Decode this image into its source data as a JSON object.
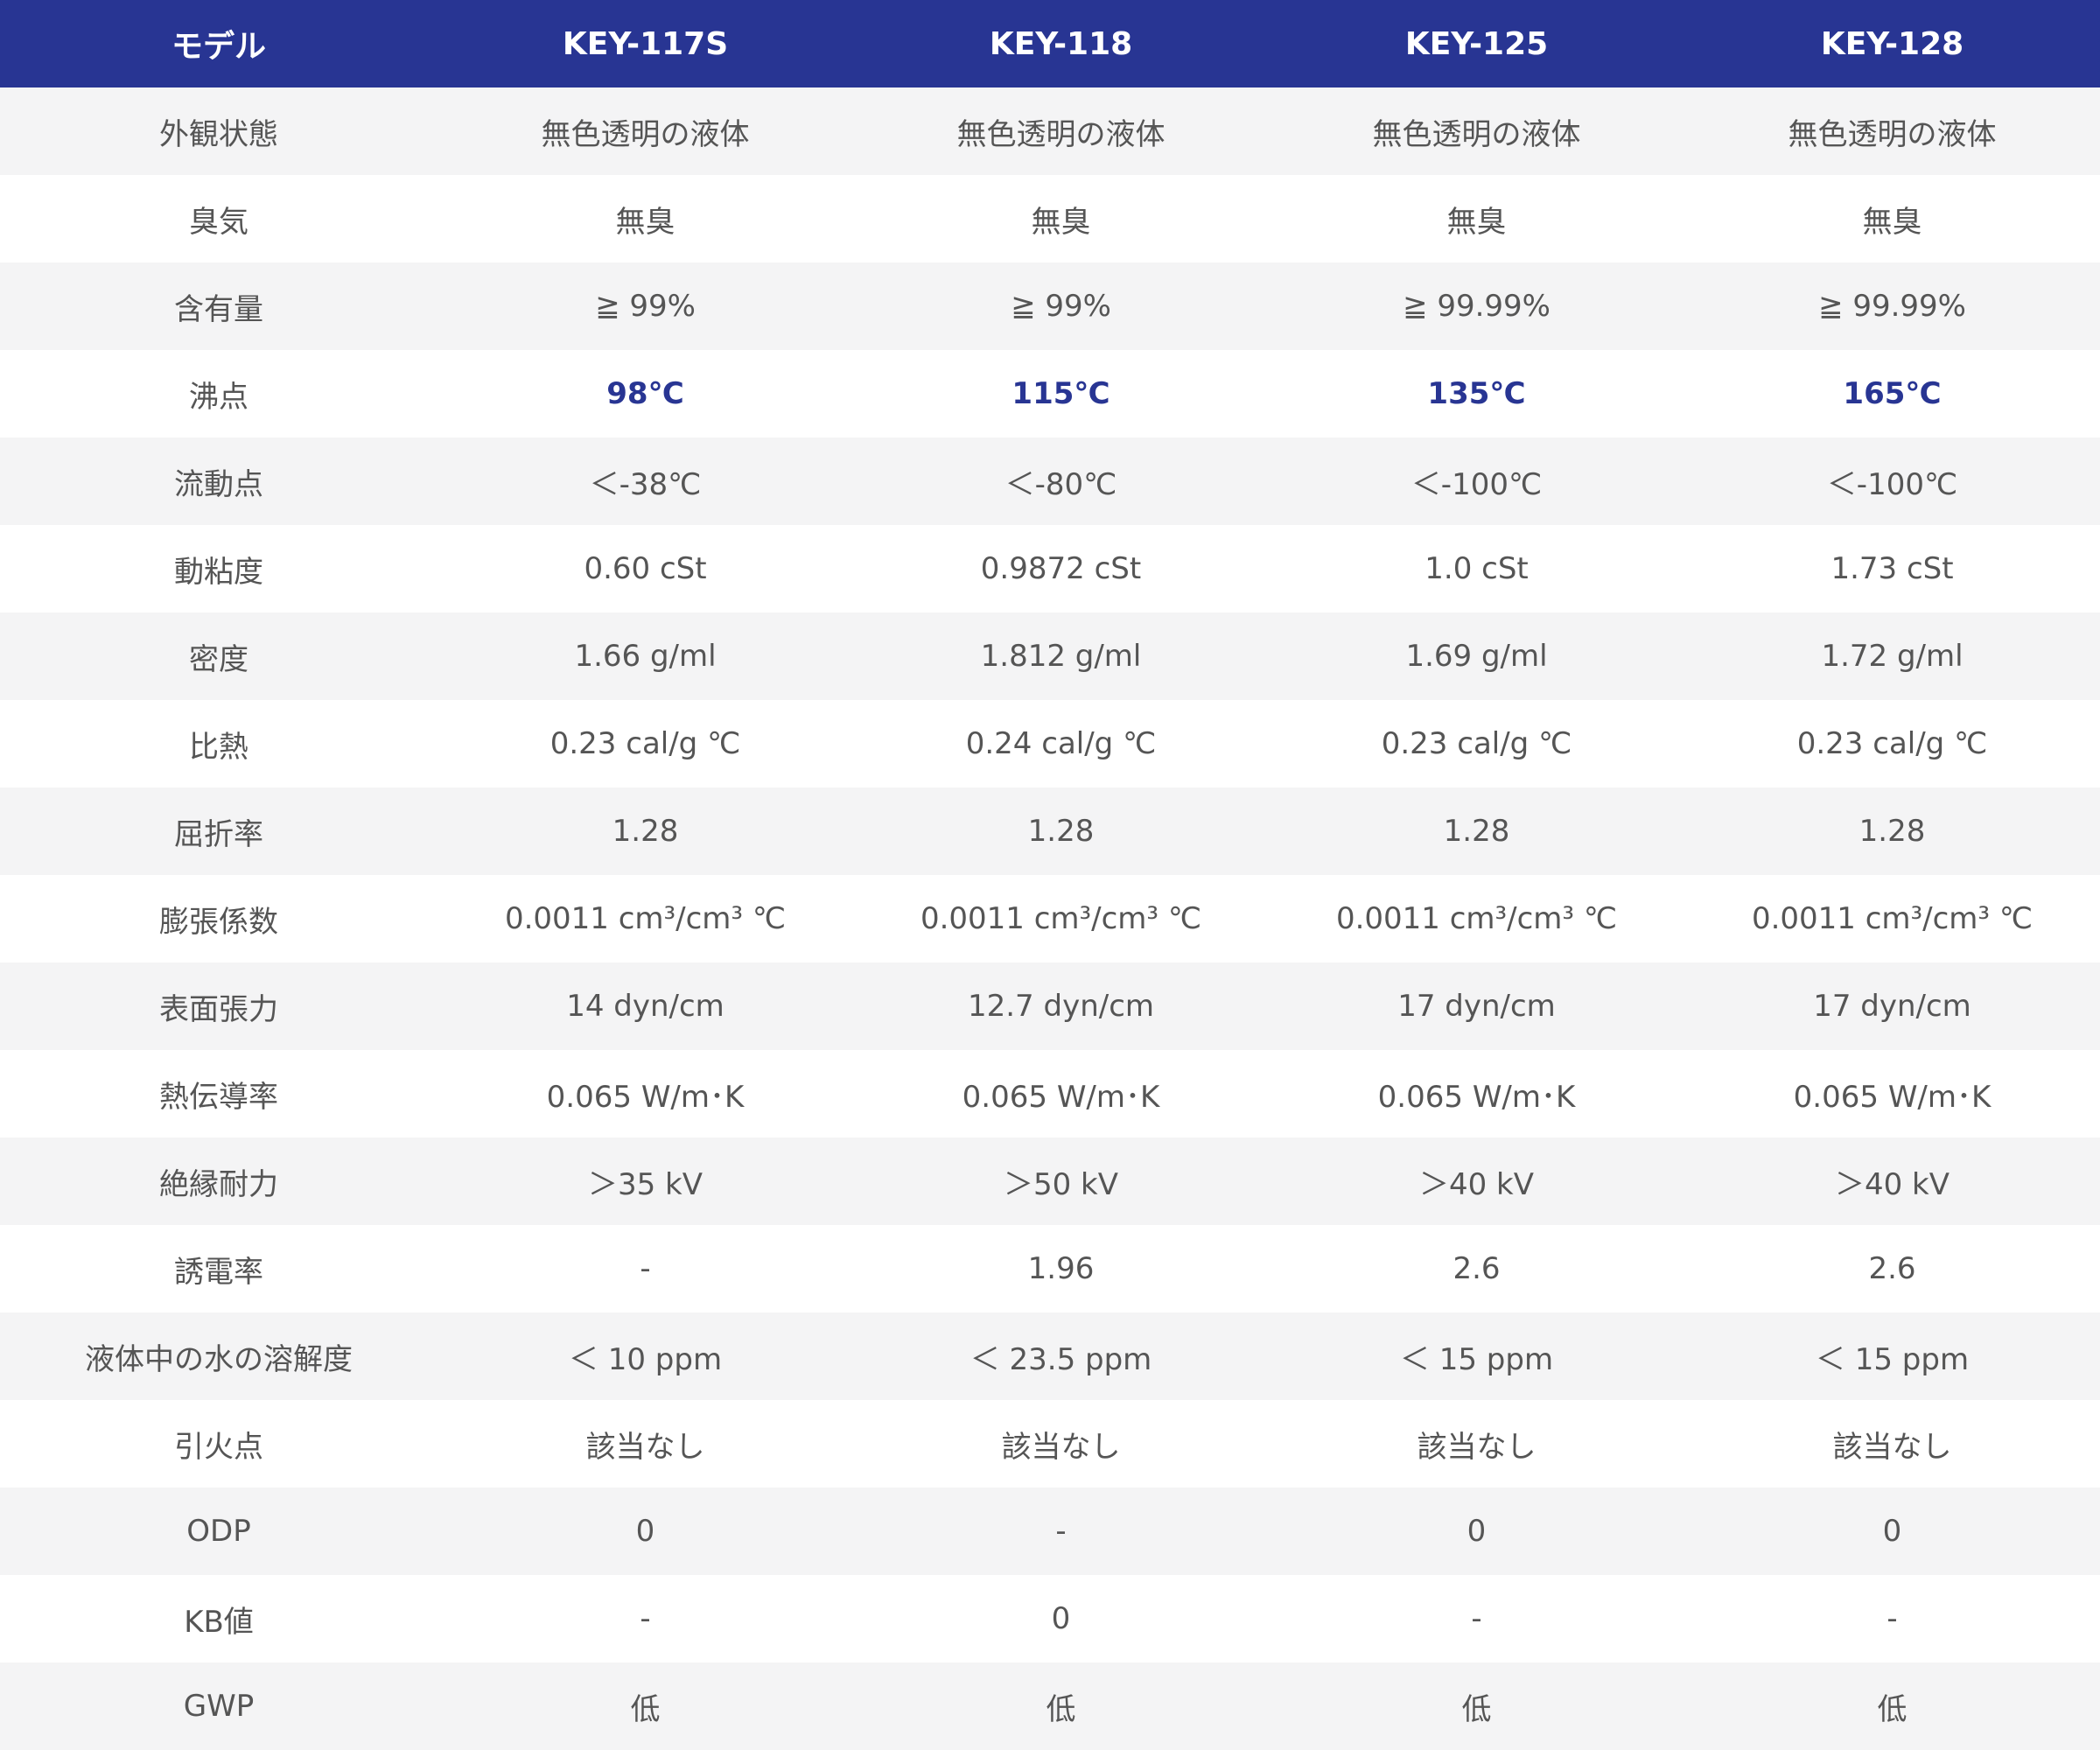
{
  "table": {
    "header": [
      "モデル",
      "KEY-117S",
      "KEY-118",
      "KEY-125",
      "KEY-128"
    ],
    "rows": [
      {
        "label": "外観状態",
        "values": [
          "無色透明の液体",
          "無色透明の液体",
          "無色透明の液体",
          "無色透明の液体"
        ]
      },
      {
        "label": "臭気",
        "values": [
          "無臭",
          "無臭",
          "無臭",
          "無臭"
        ]
      },
      {
        "label": "含有量",
        "values": [
          "≧ 99%",
          "≧ 99%",
          "≧ 99.99%",
          "≧ 99.99%"
        ]
      },
      {
        "label": "沸点",
        "values": [
          "98℃",
          "115℃",
          "135℃",
          "165℃"
        ]
      },
      {
        "label": "流動点",
        "values": [
          "＜-38℃",
          "＜-80℃",
          "＜-100℃",
          "＜-100℃"
        ]
      },
      {
        "label": "動粘度",
        "values": [
          "0.60 cSt",
          "0.9872 cSt",
          "1.0 cSt",
          "1.73 cSt"
        ]
      },
      {
        "label": "密度",
        "values": [
          "1.66 g/ml",
          "1.812 g/ml",
          "1.69 g/ml",
          "1.72 g/ml"
        ]
      },
      {
        "label": "比熱",
        "values": [
          "0.23 cal/g ℃",
          "0.24 cal/g ℃",
          "0.23 cal/g ℃",
          "0.23 cal/g ℃"
        ]
      },
      {
        "label": "屈折率",
        "values": [
          "1.28",
          "1.28",
          "1.28",
          "1.28"
        ]
      },
      {
        "label": "膨張係数",
        "values": [
          "0.0011 cm³/cm³ ℃",
          "0.0011 cm³/cm³ ℃",
          "0.0011 cm³/cm³ ℃",
          "0.0011 cm³/cm³ ℃"
        ]
      },
      {
        "label": "表面張力",
        "values": [
          "14 dyn/cm",
          "12.7 dyn/cm",
          "17 dyn/cm",
          "17 dyn/cm"
        ]
      },
      {
        "label": "熱伝導率",
        "values": [
          "0.065 W/m･K",
          "0.065 W/m･K",
          "0.065 W/m･K",
          "0.065 W/m･K"
        ]
      },
      {
        "label": "絶縁耐力",
        "values": [
          "＞35 kV",
          "＞50 kV",
          "＞40 kV",
          "＞40 kV"
        ]
      },
      {
        "label": "誘電率",
        "values": [
          "-",
          "1.96",
          "2.6",
          "2.6"
        ]
      },
      {
        "label": "液体中の水の溶解度",
        "values": [
          "＜ 10 ppm",
          "＜ 23.5 ppm",
          "＜ 15 ppm",
          "＜ 15 ppm"
        ]
      },
      {
        "label": "引火点",
        "values": [
          "該当なし",
          "該当なし",
          "該当なし",
          "該当なし"
        ]
      },
      {
        "label": "ODP",
        "values": [
          "0",
          "-",
          "0",
          "0"
        ]
      },
      {
        "label": "KB値",
        "values": [
          "-",
          "0",
          "-",
          "-"
        ]
      },
      {
        "label": "GWP",
        "values": [
          "低",
          "低",
          "低",
          "低"
        ]
      }
    ]
  },
  "colors": {
    "header_bg": "#283593",
    "header_text": "#ffffff",
    "row_alt_bg": "#f4f4f5",
    "row_bg": "#ffffff",
    "body_text": "#555555",
    "emphasis_text": "#283593"
  }
}
